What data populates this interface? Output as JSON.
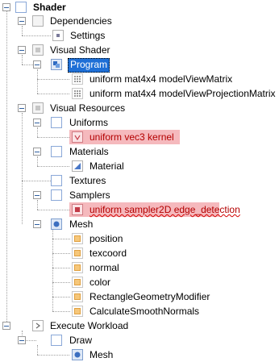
{
  "tree": {
    "root": "Shader",
    "dependencies": "Dependencies",
    "settings": "Settings",
    "visual_shader": "Visual Shader",
    "program": "Program",
    "model_view_matrix": "uniform mat4x4 modelViewMatrix",
    "model_view_projection_matrix": "uniform mat4x4 modelViewProjectionMatrix",
    "visual_resources": "Visual Resources",
    "uniforms": "Uniforms",
    "kernel": "uniform vec3 kernel",
    "materials": "Materials",
    "material": "Material",
    "textures": "Textures",
    "samplers": "Samplers",
    "edge_detection": "uniform sampler2D edge_detection",
    "mesh": "Mesh",
    "position": "position",
    "texcoord": "texcoord",
    "normal": "normal",
    "color": "color",
    "rectangle_geometry_modifier": "RectangleGeometryModifier",
    "calculate_smooth_normals": "CalculateSmoothNormals",
    "execute_workload": "Execute Workload",
    "draw": "Draw",
    "draw_mesh": "Mesh"
  },
  "colors": {
    "selection": "#1e6fd6",
    "error_background": "#f5b9bd",
    "error_text": "#b30000"
  },
  "icons": {
    "root": "shader-icon",
    "folder": "folder-icon",
    "settings": "settings-icon",
    "program": "program-icon",
    "uniform": "uniform-icon",
    "error": "error-icon",
    "material": "material-icon",
    "mesh": "mesh-icon",
    "attribute": "attribute-icon",
    "workload": "workload-icon"
  }
}
